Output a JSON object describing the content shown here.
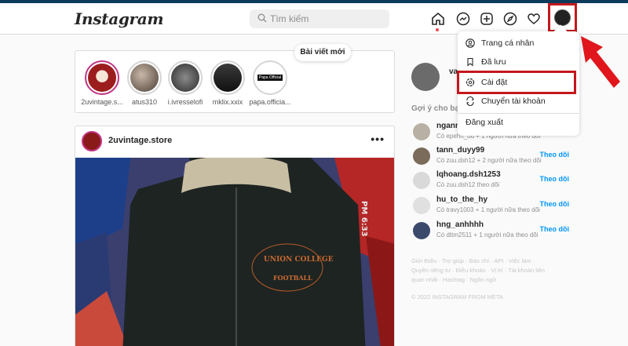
{
  "header": {
    "logo": "Instagram",
    "search_placeholder": "Tìm kiếm",
    "icons": [
      "home-icon",
      "messenger-icon",
      "new-post-icon",
      "explore-icon",
      "heart-icon",
      "profile-avatar"
    ]
  },
  "stories": [
    {
      "name": "2uvintage.s...",
      "active": true
    },
    {
      "name": "atus310",
      "active": false
    },
    {
      "name": "i.ivresselofi",
      "active": false
    },
    {
      "name": "mklix.xxix",
      "active": false
    },
    {
      "name": "papa.officia...",
      "active": false
    }
  ],
  "story_badge_text": "Papa Official",
  "new_posts_label": "Bài viết mới",
  "post": {
    "username": "2uvintage.store",
    "more": "•••",
    "photo_text": [
      "UNION COLLEGE",
      "FOOTBALL",
      "PM 6:33"
    ]
  },
  "sidebar": {
    "me_name": "va",
    "suggestions_title": "Gợi ý cho bạn",
    "suggestions": [
      {
        "name": "ngann",
        "sub": "Có epehn_ou + 1 người nữa theo dõi",
        "follow": ""
      },
      {
        "name": "tann_duyy99",
        "sub": "Có zuu.dsh12 + 2 người nữa theo dõi",
        "follow": "Theo dõi"
      },
      {
        "name": "lqhoang.dsh1253",
        "sub": "Có zuu.dsh12 theo dõi",
        "follow": "Theo dõi"
      },
      {
        "name": "hu_to_the_hy",
        "sub": "Có travy1003 + 1 người nữa theo dõi",
        "follow": "Theo dõi"
      },
      {
        "name": "hng_anhhhh",
        "sub": "Có dttm2511 + 1 người nữa theo dõi",
        "follow": "Theo dõi"
      }
    ],
    "footer_links": "Giới thiệu · Trợ giúp · Báo chí · API · Việc làm · Quyền riêng tư · Điều khoản · Vị trí · Tài khoản liên quan nhất · Hashtag · Ngôn ngữ",
    "copyright": "© 2022 INSTAGRAM FROM META"
  },
  "menu": {
    "items": [
      {
        "label": "Trang cá nhân",
        "icon": "profile-icon"
      },
      {
        "label": "Đã lưu",
        "icon": "bookmark-icon"
      },
      {
        "label": "Cài đặt",
        "icon": "settings-icon"
      },
      {
        "label": "Chuyển tài khoản",
        "icon": "switch-account-icon"
      }
    ],
    "logout": "Đăng xuất"
  },
  "colors": {
    "highlight": "#c4171c",
    "link": "#0095f6",
    "story_ring": "#c13584"
  }
}
